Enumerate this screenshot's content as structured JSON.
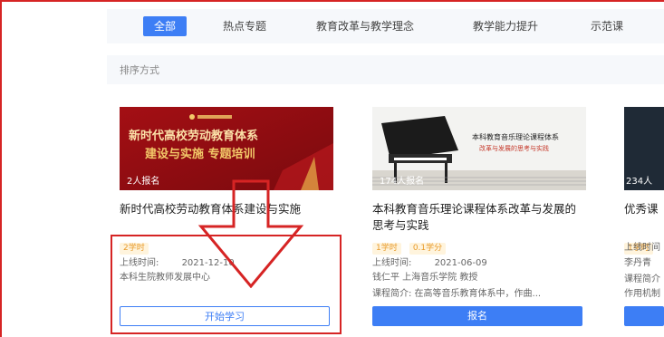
{
  "tabs": [
    {
      "label": "全部",
      "active": true
    },
    {
      "label": "热点专题",
      "active": false
    },
    {
      "label": "教育改革与教学理念",
      "active": false
    },
    {
      "label": "教学能力提升",
      "active": false
    },
    {
      "label": "示范课",
      "active": false
    }
  ],
  "sort_label": "排序方式",
  "courses": [
    {
      "thumb_line1": "新时代高校劳动教育体系",
      "thumb_line2": "建设与实施 专题培训",
      "enrolled": "2人报名",
      "title": "新时代高校劳动教育体系建设与实施",
      "tags": [
        "2学时"
      ],
      "date_label": "上线时间:",
      "date": "2021-12-10",
      "org": "本科生院教师发展中心",
      "button": "开始学习"
    },
    {
      "thumb_line1": "本科教育音乐理论课程体系",
      "thumb_line2": "改革与发展的思考与实践",
      "enrolled": "174人报名",
      "title": "本科教育音乐理论课程体系改革与发展的思考与实践",
      "tags": [
        "1学时",
        "0.1学分"
      ],
      "date_label": "上线时间:",
      "date": "2021-06-09",
      "teacher": "钱仁平 上海音乐学院 教授",
      "intro": "课程简介: 在高等音乐教育体系中，作曲...",
      "button": "报名"
    },
    {
      "enrolled": "234人",
      "title": "优秀课",
      "tags": [
        "1学时"
      ],
      "date_label": "上线时间",
      "teacher": "李丹青",
      "intro": "课程简介",
      "intro2": "作用机制"
    }
  ],
  "colors": {
    "accent": "#3d7ef5",
    "annotation": "#d62424",
    "tag": "#e89a2a"
  }
}
